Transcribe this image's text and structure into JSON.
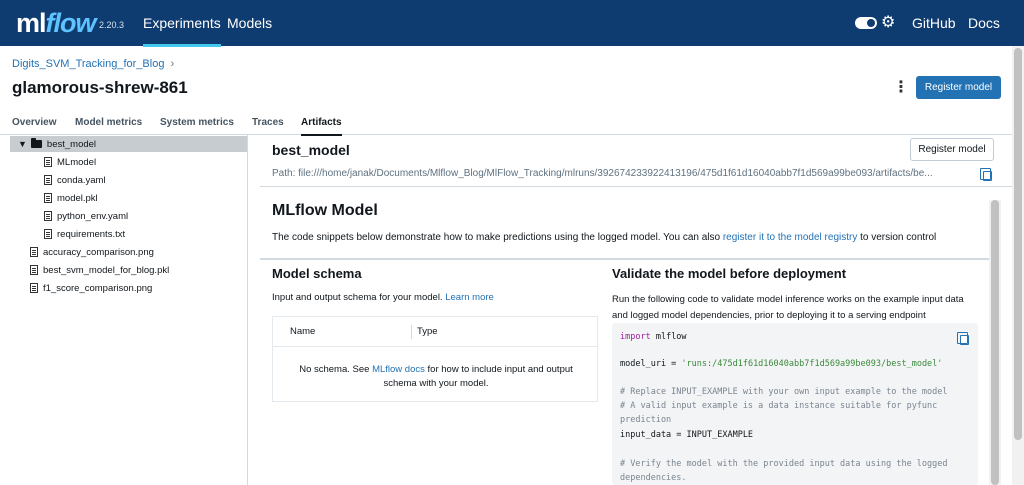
{
  "nav": {
    "logo_ml": "ml",
    "logo_flow": "flow",
    "version": "2.20.3",
    "links": [
      "Experiments",
      "Models"
    ],
    "right_links": [
      "GitHub",
      "Docs"
    ]
  },
  "header": {
    "breadcrumb": "Digits_SVM_Tracking_for_Blog",
    "breadcrumb_sep": "›",
    "run_name": "glamorous-shrew-861",
    "register_button": "Register model"
  },
  "tabs": [
    "Overview",
    "Model metrics",
    "System metrics",
    "Traces",
    "Artifacts"
  ],
  "tree": {
    "folder": "best_model",
    "children": [
      "MLmodel",
      "conda.yaml",
      "model.pkl",
      "python_env.yaml",
      "requirements.txt"
    ],
    "files": [
      "accuracy_comparison.png",
      "best_svm_model_for_blog.pkl",
      "f1_score_comparison.png"
    ]
  },
  "artifact": {
    "title": "best_model",
    "register_button": "Register model",
    "path": "Path: file:///home/janak/Documents/Mlflow_Blog/MlFlow_Tracking/mlruns/392674233922413196/475d1f61d16040abb7f1d569a99be093/artifacts/be...",
    "mlflow_heading": "MLflow Model",
    "desc_prefix": "The code snippets below demonstrate how to make predictions using the logged model. You can also ",
    "desc_link": "register it to the model registry",
    "desc_suffix": " to version control"
  },
  "schema": {
    "heading": "Model schema",
    "desc": "Input and output schema for your model. ",
    "learn_more": "Learn more",
    "col_name": "Name",
    "col_type": "Type",
    "empty_prefix": "No schema. See ",
    "empty_link": "MLflow docs",
    "empty_suffix": " for how to include input and output schema with your model."
  },
  "validate": {
    "heading": "Validate the model before deployment",
    "desc": "Run the following code to validate model inference works on the example input data and logged model dependencies, prior to deploying it to a serving endpoint",
    "code": {
      "l1_kw": "import",
      "l1_rest": " mlflow",
      "l2_var": "model_uri = ",
      "l2_str": "'runs:/475d1f61d16040abb7f1d569a99be093/best_model'",
      "c1": "# Replace INPUT_EXAMPLE with your own input example to the model",
      "c2": "# A valid input example is a data instance suitable for pyfunc",
      "c3": "prediction",
      "l3": "input_data = INPUT_EXAMPLE",
      "c4": "# Verify the model with the provided input data using the logged",
      "c5": "dependencies."
    }
  },
  "colors": {
    "nav_bg": "#0e3b70",
    "primary": "#2272b4",
    "accent": "#43c9ed"
  }
}
